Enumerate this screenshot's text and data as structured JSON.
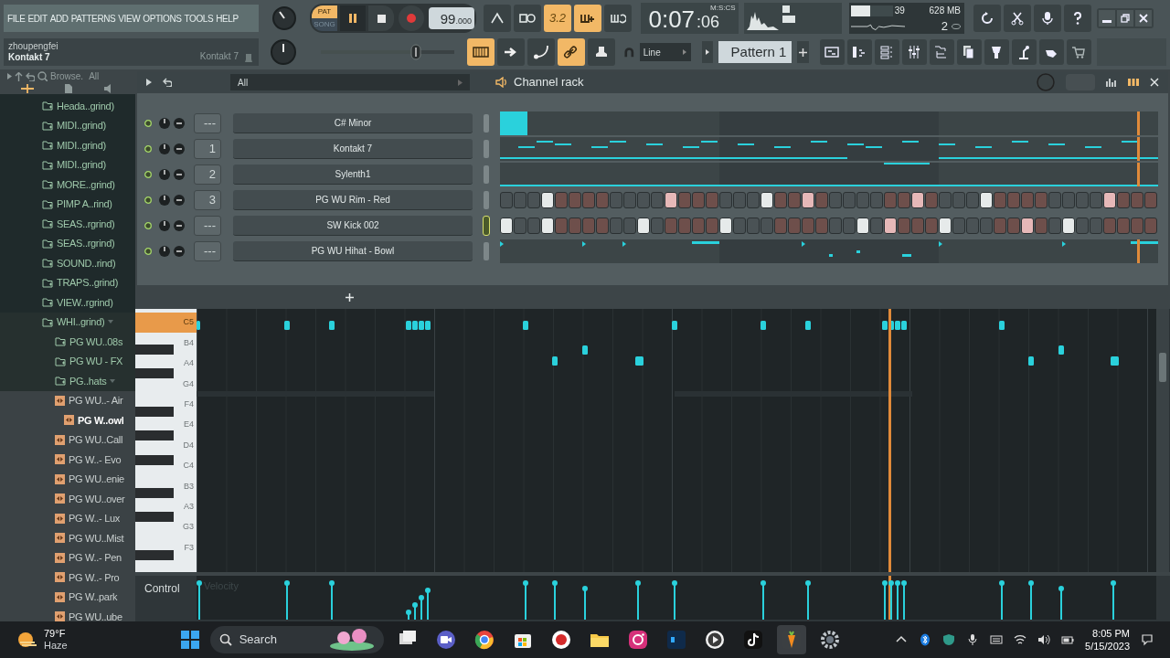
{
  "menu": [
    "FILE",
    "EDIT",
    "ADD",
    "PATTERNS",
    "VIEW",
    "OPTIONS",
    "TOOLS",
    "HELP"
  ],
  "hint": {
    "title": "zhoupengfei",
    "subtitle": "Kontakt 7",
    "channel": "Kontakt 7"
  },
  "transport": {
    "modes": [
      {
        "label": "PAT",
        "selected": true
      },
      {
        "label": "SONG",
        "selected": false
      }
    ],
    "tempo": "99",
    "tempo_fraction": ".000"
  },
  "toolbar_top": [
    {
      "kind": "metronome",
      "on": false
    },
    {
      "kind": "wait",
      "on": false
    },
    {
      "kind": "countdown",
      "label": "3.2",
      "on": true
    },
    {
      "kind": "step",
      "on": true
    },
    {
      "kind": "loop",
      "on": false
    }
  ],
  "time": {
    "main": "0:07",
    "sub": ":06",
    "unit": "M:S:CS"
  },
  "cpu": {
    "level": 0.47,
    "polyphony": "39",
    "memory": "628 MB",
    "count": "2"
  },
  "toolbar_bottom": [
    {
      "kind": "keyboard",
      "on": true
    },
    {
      "kind": "arrow",
      "on": false
    },
    {
      "kind": "note",
      "on": false
    },
    {
      "kind": "link",
      "on": true
    },
    {
      "kind": "stamp",
      "on": false
    }
  ],
  "master_volume": {
    "level": 0.71
  },
  "snap": "Line",
  "pattern": "Pattern 1",
  "browser": {
    "label": "Browse.",
    "filter": "All",
    "tree": [
      {
        "label": "Heada..grind)",
        "kind": "folder",
        "expanded": false,
        "selected": false
      },
      {
        "label": "MIDI..grind)",
        "kind": "folder",
        "expanded": false,
        "selected": false
      },
      {
        "label": "MIDI..grind)",
        "kind": "folder",
        "expanded": false,
        "selected": false
      },
      {
        "label": "MIDI..grind)",
        "kind": "folder",
        "expanded": false,
        "selected": false
      },
      {
        "label": "MORE..grind)",
        "kind": "folder",
        "expanded": false,
        "selected": false
      },
      {
        "label": "PIMP A..rind)",
        "kind": "folder",
        "expanded": false,
        "selected": false
      },
      {
        "label": "SEAS..rgrind)",
        "kind": "folder",
        "expanded": false,
        "selected": false
      },
      {
        "label": "SEAS..rgrind)",
        "kind": "folder",
        "expanded": false,
        "selected": false
      },
      {
        "label": "SOUND..rind)",
        "kind": "folder",
        "expanded": false,
        "selected": false
      },
      {
        "label": "TRAPS..grind)",
        "kind": "folder",
        "expanded": false,
        "selected": false
      },
      {
        "label": "VIEW..rgrind)",
        "kind": "folder",
        "expanded": false,
        "selected": false
      },
      {
        "label": "WHI..grind)",
        "kind": "folder",
        "expanded": true,
        "selected": false,
        "children": [
          {
            "label": "PG WU..08s",
            "kind": "folder",
            "expanded": false,
            "selected": false
          },
          {
            "label": "PG WU - FX",
            "kind": "folder",
            "expanded": false,
            "selected": false
          },
          {
            "label": "PG..hats",
            "kind": "folder",
            "expanded": true,
            "selected": false,
            "children": [
              {
                "label": "PG WU..- Air",
                "kind": "sample",
                "selected": false
              },
              {
                "label": "PG W..owl",
                "kind": "sample",
                "selected": true
              },
              {
                "label": "PG WU..Call",
                "kind": "sample",
                "selected": false
              },
              {
                "label": "PG W..- Evo",
                "kind": "sample",
                "selected": false
              },
              {
                "label": "PG WU..enie",
                "kind": "sample",
                "selected": false
              },
              {
                "label": "PG WU..over",
                "kind": "sample",
                "selected": false
              },
              {
                "label": "PG W..- Lux",
                "kind": "sample",
                "selected": false
              },
              {
                "label": "PG WU..Mist",
                "kind": "sample",
                "selected": false
              },
              {
                "label": "PG W..- Pen",
                "kind": "sample",
                "selected": false
              },
              {
                "label": "PG W..- Pro",
                "kind": "sample",
                "selected": false
              },
              {
                "label": "PG W..park",
                "kind": "sample",
                "selected": false
              },
              {
                "label": "PG WU..ube",
                "kind": "sample",
                "selected": false
              }
            ]
          }
        ]
      }
    ]
  },
  "channel_rack": {
    "title": "Channel rack",
    "filter": "All",
    "channels": [
      {
        "name": "C# Minor",
        "route": "---",
        "selected": false,
        "kind": "pattern"
      },
      {
        "name": "Kontakt 7",
        "route": "1",
        "selected": false,
        "kind": "pattern"
      },
      {
        "name": "Sylenth1",
        "route": "2",
        "selected": false,
        "kind": "pattern"
      },
      {
        "name": "PG WU Rim - Red",
        "route": "3",
        "selected": false,
        "kind": "steps",
        "steps": [
          false,
          false,
          false,
          true,
          false,
          false,
          false,
          false,
          false,
          false,
          false,
          false,
          true,
          false,
          false,
          false,
          false,
          false,
          false,
          true,
          false,
          false,
          true,
          false,
          false,
          false,
          false,
          false,
          false,
          false,
          true,
          false,
          false,
          false,
          false,
          true,
          false,
          false,
          false,
          false,
          false,
          false,
          false,
          false,
          true,
          false,
          false,
          false
        ]
      },
      {
        "name": "SW Kick 002",
        "route": "---",
        "selected": true,
        "kind": "steps",
        "steps": [
          true,
          false,
          false,
          true,
          false,
          false,
          false,
          false,
          false,
          false,
          true,
          false,
          false,
          false,
          false,
          false,
          true,
          false,
          false,
          false,
          false,
          false,
          false,
          false,
          false,
          false,
          true,
          false,
          true,
          false,
          false,
          false,
          true,
          false,
          false,
          false,
          false,
          false,
          true,
          false,
          false,
          true,
          false,
          false,
          false,
          false,
          false,
          false
        ]
      },
      {
        "name": "PG WU Hihat - Bowl",
        "route": "---",
        "selected": false,
        "kind": "pattern"
      }
    ]
  },
  "piano_roll": {
    "keys": [
      {
        "label": "C5",
        "selected": true
      },
      {
        "label": "B4",
        "selected": false
      },
      {
        "label": "A4",
        "selected": false
      },
      {
        "label": "G4",
        "selected": false
      },
      {
        "label": "F4",
        "selected": false
      },
      {
        "label": "E4",
        "selected": false
      },
      {
        "label": "D4",
        "selected": false
      },
      {
        "label": "C4",
        "selected": false
      },
      {
        "label": "B3",
        "selected": false
      },
      {
        "label": "A3",
        "selected": false
      },
      {
        "label": "G3",
        "selected": false
      },
      {
        "label": "F3",
        "selected": false
      }
    ],
    "control": "Control",
    "parameter": "Velocity"
  },
  "taskbar": {
    "temperature": "79°F",
    "weather": "Haze",
    "search": "Search",
    "time": "8:05 PM",
    "date": "5/15/2023"
  }
}
